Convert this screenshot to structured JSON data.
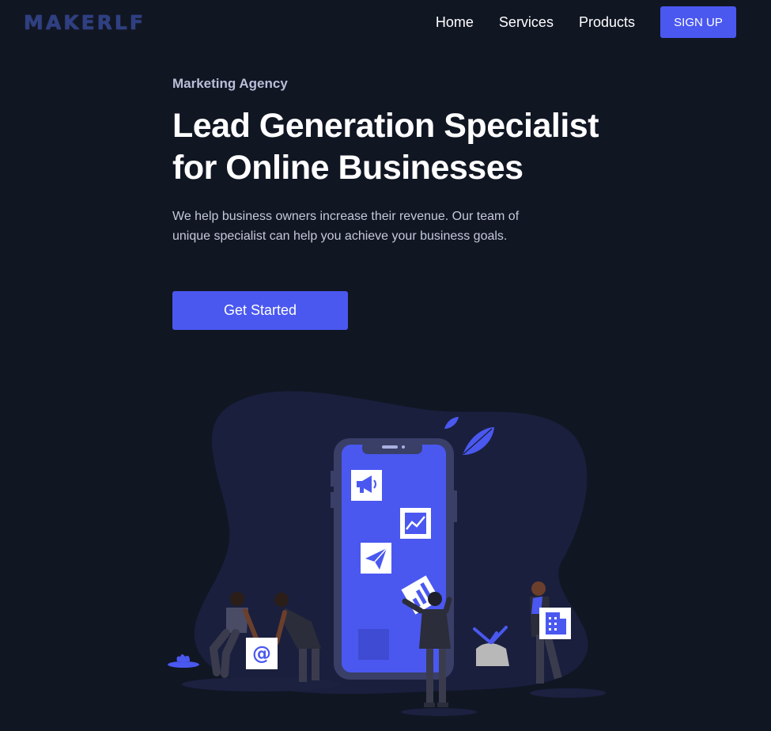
{
  "header": {
    "logo_text": "MAKERLF",
    "nav": [
      {
        "label": "Home"
      },
      {
        "label": "Services"
      },
      {
        "label": "Products"
      }
    ],
    "signup_label": "SIGN UP"
  },
  "hero": {
    "eyebrow": "Marketing Agency",
    "headline_line1": "Lead Generation Specialist",
    "headline_line2": "for Online Businesses",
    "description": "We help business owners increase their revenue. Our team of unique specialist can help you achieve your business goals.",
    "cta_label": "Get Started"
  },
  "illustration": {
    "email_symbol": "@"
  },
  "colors": {
    "background": "#111623",
    "accent": "#4a58f0",
    "blob": "#1a1f3d",
    "logo": "#2e3f82"
  }
}
